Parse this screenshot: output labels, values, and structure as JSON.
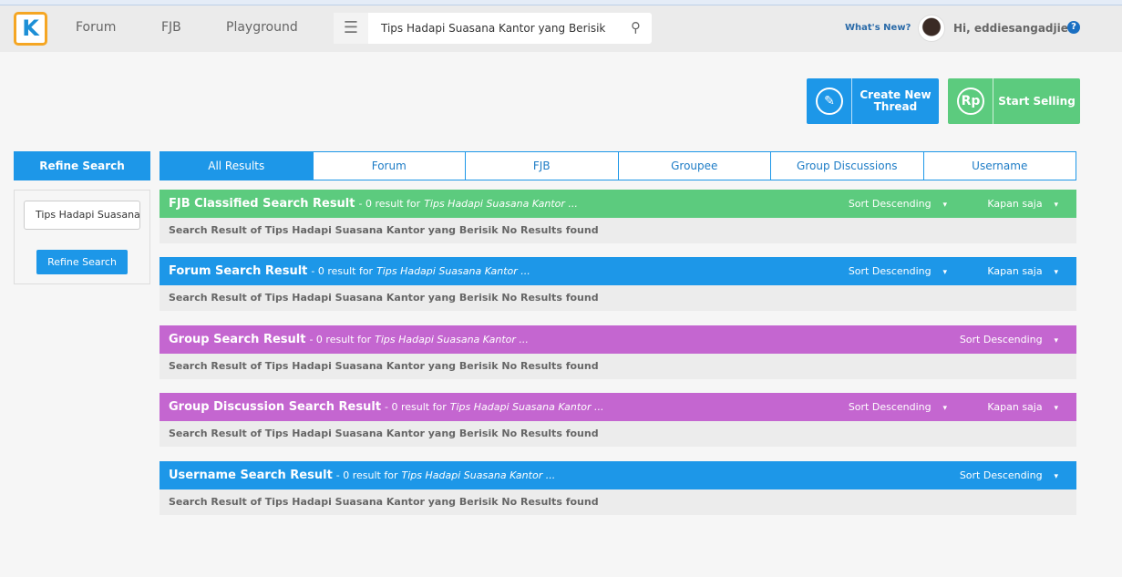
{
  "header": {
    "logo": "K",
    "nav": [
      "Forum",
      "FJB",
      "Playground"
    ],
    "search_value": "Tips Hadapi Suasana Kantor yang Berisik",
    "whats_new": "What's New?",
    "greeting": "Hi, eddiesangadjie",
    "help": "?"
  },
  "actions": {
    "create_thread": "Create New Thread",
    "start_selling": "Start Selling",
    "rp_icon": "Rp"
  },
  "sidebar": {
    "title": "Refine Search",
    "input_value": "Tips Hadapi Suasana Kantor yang Berisik",
    "button": "Refine Search"
  },
  "tabs": [
    {
      "label": "All Results",
      "active": true
    },
    {
      "label": "Forum"
    },
    {
      "label": "FJB"
    },
    {
      "label": "Groupee"
    },
    {
      "label": "Group Discussions"
    },
    {
      "label": "Username"
    }
  ],
  "sections": [
    {
      "title": "FJB Classified Search Result",
      "summary": "- 0 result for",
      "query": "Tips Hadapi Suasana Kantor ...",
      "sort": "Sort Descending",
      "time": "Kapan saja",
      "color": "#5ccb7e",
      "body": "Search Result of Tips Hadapi Suasana Kantor yang Berisik No Results found"
    },
    {
      "title": "Forum Search Result",
      "summary": "- 0 result for",
      "query": "Tips Hadapi Suasana Kantor ...",
      "sort": "Sort Descending",
      "time": "Kapan saja",
      "color": "#1d97e8",
      "body": "Search Result of Tips Hadapi Suasana Kantor yang Berisik No Results found"
    },
    {
      "title": "Group Search Result",
      "summary": "- 0 result for",
      "query": "Tips Hadapi Suasana Kantor ...",
      "sort": "Sort Descending",
      "color": "#c466d0",
      "body": "Search Result of Tips Hadapi Suasana Kantor yang Berisik No Results found"
    },
    {
      "title": "Group Discussion Search Result",
      "summary": "- 0 result for",
      "query": "Tips Hadapi Suasana Kantor ...",
      "sort": "Sort Descending",
      "time": "Kapan saja",
      "color": "#c466d0",
      "body": "Search Result of Tips Hadapi Suasana Kantor yang Berisik No Results found"
    },
    {
      "title": "Username Search Result",
      "summary": "- 0 result for",
      "query": "Tips Hadapi Suasana Kantor ...",
      "sort": "Sort Descending",
      "color": "#1d97e8",
      "body": "Search Result of Tips Hadapi Suasana Kantor yang Berisik No Results found"
    }
  ]
}
